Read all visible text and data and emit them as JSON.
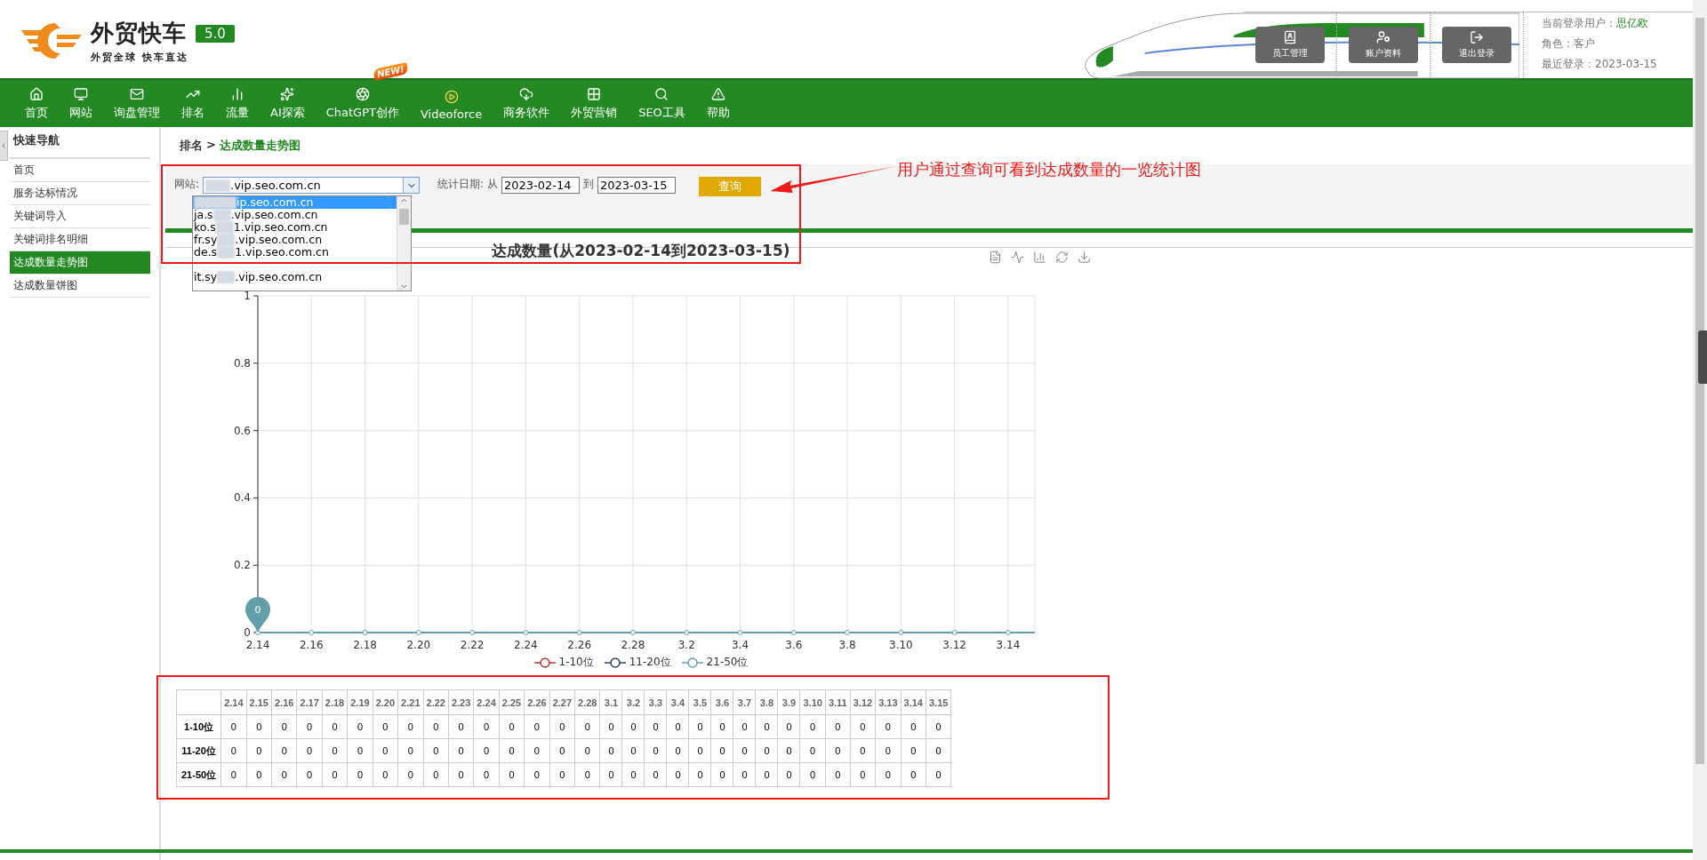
{
  "header": {
    "logo": {
      "title": "外贸快车",
      "version": "5.0",
      "slogan": "外贸全球 快车直达"
    },
    "actions": [
      {
        "kind": "staff",
        "label": "员工管理"
      },
      {
        "kind": "account",
        "label": "账户资料"
      },
      {
        "kind": "logout",
        "label": "退出登录"
      }
    ],
    "user": {
      "current_label": "当前登录用户：",
      "current_name": "思亿欧",
      "role": "角色：客户",
      "last_login": "最近登录：2023-03-15"
    }
  },
  "nav": [
    {
      "kind": "home",
      "label": "首页"
    },
    {
      "kind": "monitor",
      "label": "网站"
    },
    {
      "kind": "mail",
      "label": "询盘管理"
    },
    {
      "kind": "rank",
      "label": "排名"
    },
    {
      "kind": "bars",
      "label": "流量"
    },
    {
      "kind": "ai",
      "label": "AI探索"
    },
    {
      "kind": "gpt",
      "label": "ChatGPT创作",
      "badge": "NEW!"
    },
    {
      "kind": "video",
      "label": "Videoforce"
    },
    {
      "kind": "cloud",
      "label": "商务软件"
    },
    {
      "kind": "grid",
      "label": "外贸营销"
    },
    {
      "kind": "search",
      "label": "SEO工具"
    },
    {
      "kind": "alert",
      "label": "帮助"
    }
  ],
  "sidebar": {
    "title": "快速导航",
    "items": [
      {
        "label": "首页",
        "selected": false
      },
      {
        "label": "服务达标情况",
        "selected": false
      },
      {
        "label": "关键词导入",
        "selected": false
      },
      {
        "label": "关键词排名明细",
        "selected": false
      },
      {
        "label": "达成数量走势图",
        "selected": true
      },
      {
        "label": "达成数量饼图",
        "selected": false
      }
    ]
  },
  "breadcrumb": {
    "parent": "排名",
    "separator": ">",
    "current": "达成数量走势图"
  },
  "filter": {
    "site_label": "网站:",
    "site_value": ".vip.seo.com.cn",
    "site_options": [
      {
        "suffix": "ip.seo.com.cn",
        "selected": true
      },
      {
        "prefix": "ja.s",
        "suffix": ".vip.seo.com.cn",
        "selected": false
      },
      {
        "prefix": "ko.s",
        "suffix": "1.vip.seo.com.cn",
        "selected": false
      },
      {
        "prefix": "fr.sy",
        "suffix": ".vip.seo.com.cn",
        "selected": false
      },
      {
        "prefix": "de.s",
        "suffix": "1.vip.seo.com.cn",
        "selected": false
      },
      {
        "selected": false
      },
      {
        "prefix": "it.sy",
        "suffix": ".vip.seo.com.cn",
        "selected": false
      }
    ],
    "date_label": "统计日期: 从",
    "date_from": "2023-02-14",
    "date_to_label": "到",
    "date_to": "2023-03-15",
    "query_button": "查询"
  },
  "callout": "用户通过查询可看到达成数量的一览统计图",
  "chart": {
    "chart_data": {
      "type": "line",
      "title": "达成数量(从2023-02-14到2023-03-15)",
      "categories": [
        "2.14",
        null,
        "2.16",
        null,
        "2.18",
        null,
        "2.20",
        null,
        "2.22",
        null,
        "2.24",
        null,
        "2.26",
        null,
        "2.28",
        null,
        "3.2",
        null,
        "3.4",
        null,
        "3.6",
        null,
        "3.8",
        null,
        "3.10",
        null,
        "3.12",
        null,
        "3.14",
        null
      ],
      "series": [
        {
          "name": "1-10位",
          "color": "#c23531",
          "values": [
            null,
            null,
            null,
            null,
            null,
            null,
            null,
            null,
            null,
            null,
            null,
            null,
            null,
            null,
            null,
            null,
            null,
            null,
            null,
            null,
            null,
            null,
            null,
            null,
            null,
            null,
            null,
            null,
            null,
            null
          ]
        },
        {
          "name": "11-20位",
          "color": "#2f4554",
          "values": [
            null,
            null,
            null,
            null,
            null,
            null,
            null,
            null,
            null,
            null,
            null,
            null,
            null,
            null,
            null,
            null,
            null,
            null,
            null,
            null,
            null,
            null,
            null,
            null,
            null,
            null,
            null,
            null,
            null,
            null
          ]
        },
        {
          "name": "21-50位",
          "color": "#61a0a8",
          "values": [
            0,
            0,
            0,
            0,
            0,
            0,
            0,
            0,
            0,
            0,
            0,
            0,
            0,
            0,
            0,
            0,
            0,
            0,
            0,
            0,
            0,
            0,
            0,
            0,
            0,
            0,
            0,
            0,
            0,
            0
          ]
        }
      ],
      "ylim": [
        0,
        1
      ],
      "yticks": [
        0,
        0.2,
        0.4,
        0.6,
        0.8,
        1
      ],
      "grid": true,
      "legend": true,
      "annotations": [
        "0"
      ]
    }
  },
  "table": {
    "columns": [
      "2.14",
      "2.15",
      "2.16",
      "2.17",
      "2.18",
      "2.19",
      "2.20",
      "2.21",
      "2.22",
      "2.23",
      "2.24",
      "2.25",
      "2.26",
      "2.27",
      "2.28",
      "3.1",
      "3.2",
      "3.3",
      "3.4",
      "3.5",
      "3.6",
      "3.7",
      "3.8",
      "3.9",
      "3.10",
      "3.11",
      "3.12",
      "3.13",
      "3.14",
      "3.15"
    ],
    "rows": [
      {
        "label": "1-10位",
        "values": [
          "0",
          "0",
          "0",
          "0",
          "0",
          "0",
          "0",
          "0",
          "0",
          "0",
          "0",
          "0",
          "0",
          "0",
          "0",
          "0",
          "0",
          "0",
          "0",
          "0",
          "0",
          "0",
          "0",
          "0",
          "0",
          "0",
          "0",
          "0",
          "0",
          "0"
        ]
      },
      {
        "label": "11-20位",
        "values": [
          "0",
          "0",
          "0",
          "0",
          "0",
          "0",
          "0",
          "0",
          "0",
          "0",
          "0",
          "0",
          "0",
          "0",
          "0",
          "0",
          "0",
          "0",
          "0",
          "0",
          "0",
          "0",
          "0",
          "0",
          "0",
          "0",
          "0",
          "0",
          "0",
          "0"
        ]
      },
      {
        "label": "21-50位",
        "values": [
          "0",
          "0",
          "0",
          "0",
          "0",
          "0",
          "0",
          "0",
          "0",
          "0",
          "0",
          "0",
          "0",
          "0",
          "0",
          "0",
          "0",
          "0",
          "0",
          "0",
          "0",
          "0",
          "0",
          "0",
          "0",
          "0",
          "0",
          "0",
          "0",
          "0"
        ]
      }
    ]
  }
}
